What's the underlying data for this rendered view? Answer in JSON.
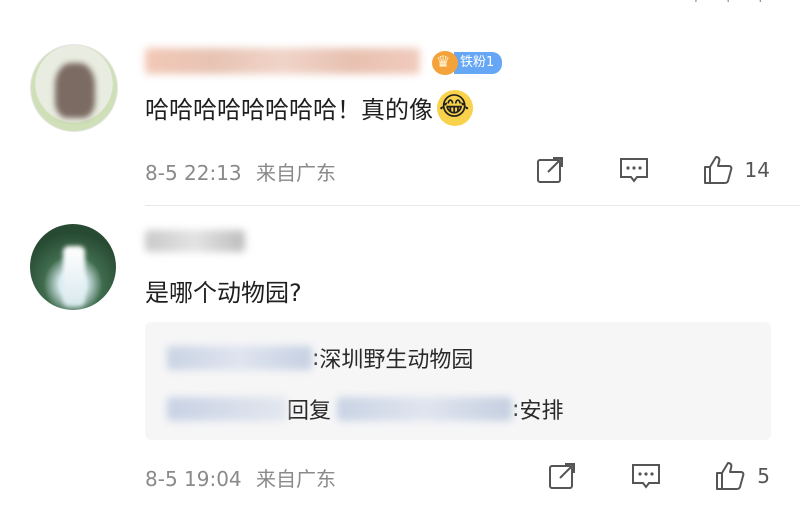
{
  "comments": [
    {
      "badge": "铁粉1",
      "text": "哈哈哈哈哈哈哈哈！真的像",
      "emoji": "laughing-tears-emoji",
      "time": "8-5 22:13",
      "location": "来自广东",
      "likes": "14"
    },
    {
      "text": "是哪个动物园?",
      "replies": [
        {
          "sep": ": ",
          "text": "深圳野生动物园"
        },
        {
          "mid": "回复",
          "sep": ":",
          "text": "安排"
        }
      ],
      "time": "8-5 19:04",
      "location": "来自广东",
      "likes": "5"
    }
  ],
  "icons": {
    "share": "share-icon",
    "comment": "comment-icon",
    "like": "like-icon"
  },
  "colors": {
    "badge": "#66a7f5",
    "crown": "#f4a23a",
    "meta": "#8a8a8a"
  }
}
